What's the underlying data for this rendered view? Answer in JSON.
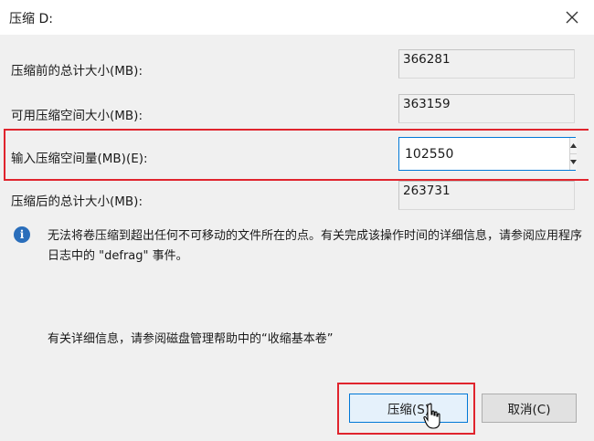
{
  "window": {
    "title": "压缩 D:",
    "close_icon": "close-icon"
  },
  "fields": {
    "total_before_label": "压缩前的总计大小(MB):",
    "total_before_value": "366281",
    "available_label": "可用压缩空间大小(MB):",
    "available_value": "363159",
    "input_label": "输入压缩空间量(MB)(E):",
    "input_value": "102550",
    "total_after_label": "压缩后的总计大小(MB):",
    "total_after_value": "263731"
  },
  "info": {
    "icon": "info-icon",
    "message": "无法将卷压缩到超出任何不可移动的文件所在的点。有关完成该操作时间的详细信息，请参阅应用程序日志中的 \"defrag\" 事件。",
    "help": "有关详细信息，请参阅磁盘管理帮助中的“收缩基本卷”"
  },
  "buttons": {
    "shrink_label": "压缩(S)",
    "cancel_label": "取消(C)"
  },
  "colors": {
    "highlight": "#e0242d",
    "accent": "#0078d7",
    "info_icon": "#2a6ebb"
  }
}
